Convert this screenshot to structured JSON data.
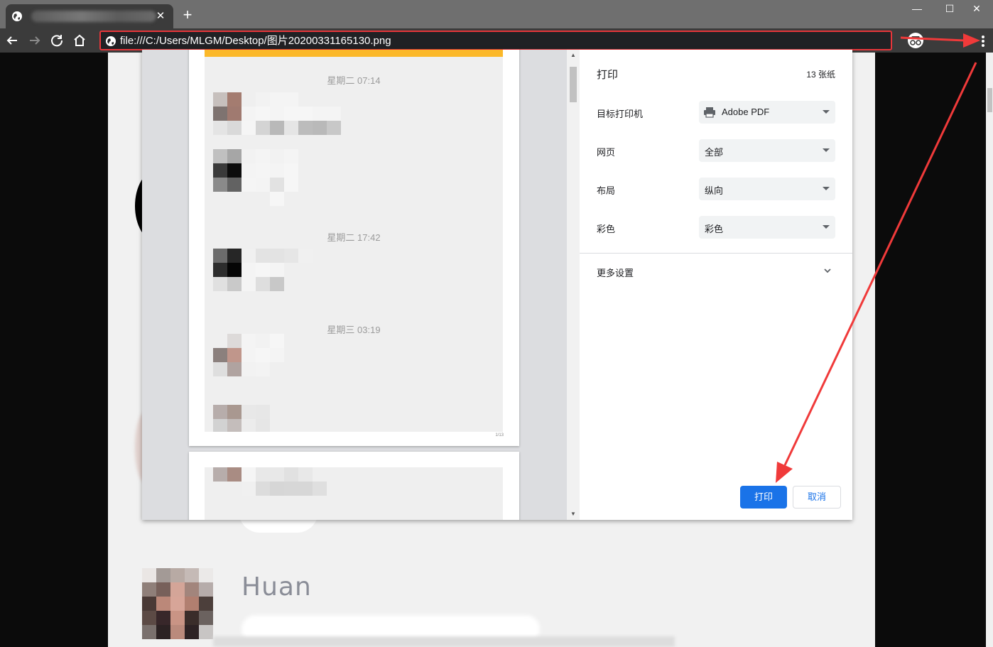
{
  "browser": {
    "new_tab_symbol": "+",
    "tab_close_symbol": "✕",
    "window_controls": [
      "—",
      "☐",
      "✕"
    ],
    "url": "file:///C:/Users/MLGM/Desktop/图片20200331165130.png",
    "icons": [
      "globe-icon",
      "back-icon",
      "forward-icon",
      "reload-icon",
      "home-icon",
      "incognito-icon",
      "menu-dots-icon"
    ]
  },
  "preview": {
    "timestamps": [
      "星期二 07:14",
      "星期二 17:42",
      "星期三 03:19"
    ],
    "page_number": "1/13",
    "accent_color": "#fbb829"
  },
  "print": {
    "title": "打印",
    "sheet_count": "13 张纸",
    "rows": [
      {
        "label": "目标打印机",
        "value": "Adobe PDF",
        "icon": "printer-icon"
      },
      {
        "label": "网页",
        "value": "全部"
      },
      {
        "label": "布局",
        "value": "纵向"
      },
      {
        "label": "彩色",
        "value": "彩色"
      }
    ],
    "more_settings": "更多设置",
    "print_button": "打印",
    "cancel_button": "取消",
    "primary_color": "#1a73e8"
  },
  "page": {
    "name": "Huan"
  },
  "annotation": {
    "arrow_color": "#f03a3a"
  }
}
